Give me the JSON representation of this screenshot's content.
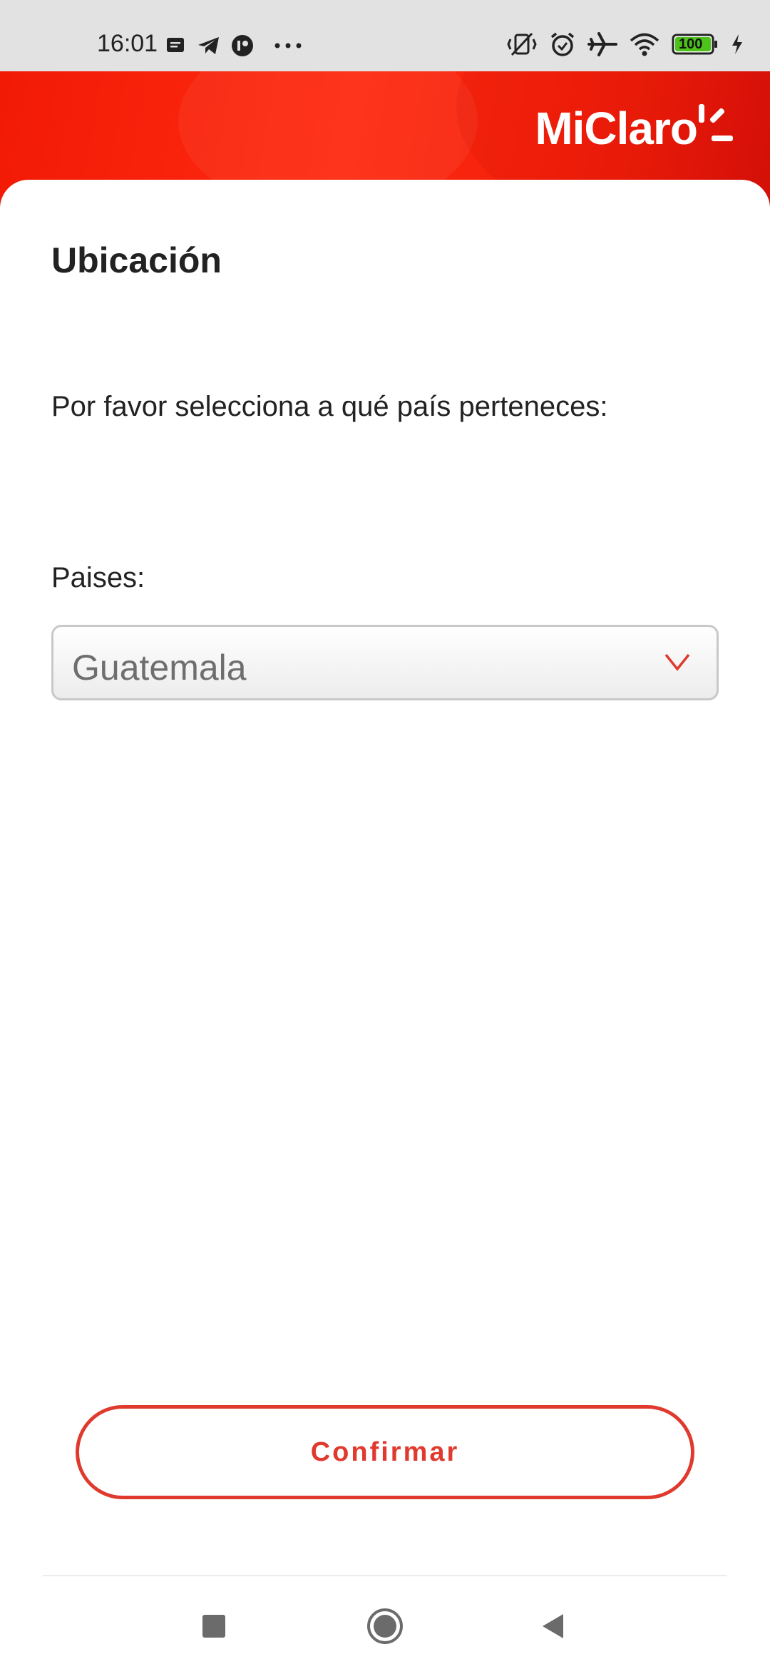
{
  "status_bar": {
    "time": "16:01",
    "battery": "100",
    "left_icons": [
      "notification-icon",
      "telegram-icon",
      "app-icon",
      "more-icon"
    ],
    "right_icons": [
      "vibrate-icon",
      "alarm-icon",
      "airplane-icon",
      "wifi-icon",
      "battery-icon",
      "charging-icon"
    ]
  },
  "header": {
    "brand": "MiClaro"
  },
  "page": {
    "title": "Ubicación",
    "prompt": "Por favor selecciona a qué país perteneces:",
    "field_label": "Paises:",
    "select": {
      "value": "Guatemala"
    },
    "confirm_label": "Confirmar"
  },
  "colors": {
    "brand_red": "#f21a05",
    "accent": "#e03a2e",
    "text": "#222222"
  },
  "nav": {
    "icons": [
      "recents-icon",
      "home-icon",
      "back-icon"
    ]
  }
}
